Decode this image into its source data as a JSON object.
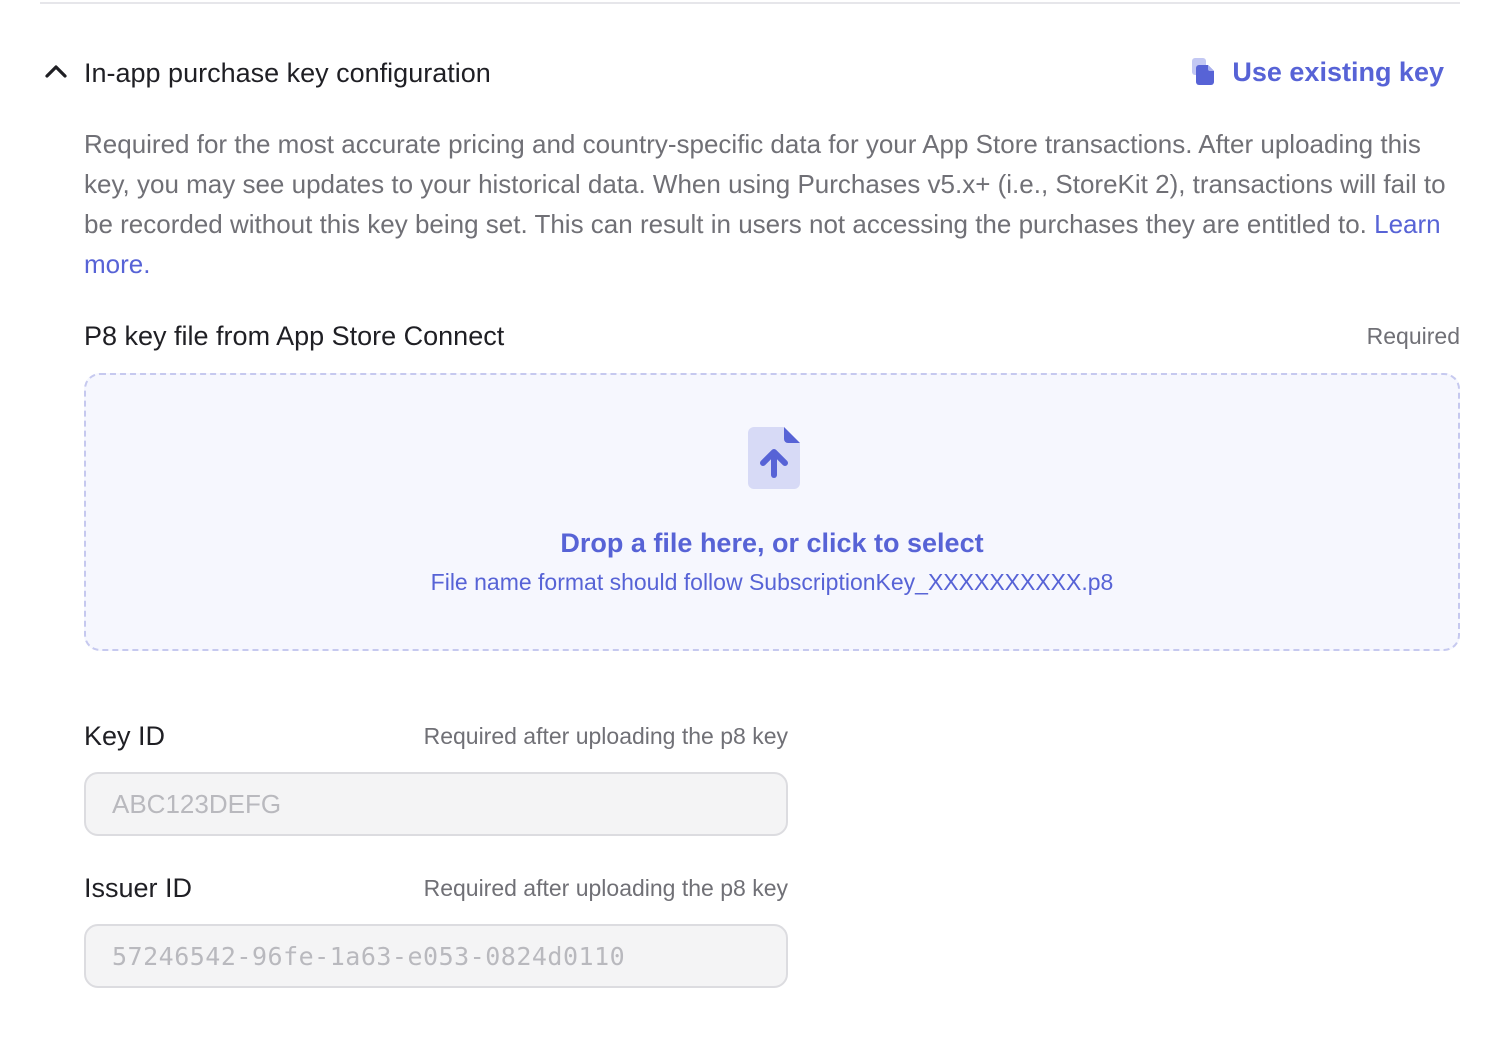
{
  "section": {
    "title": "In-app purchase key configuration",
    "use_existing_label": "Use existing key",
    "description_text": "Required for the most accurate pricing and country-specific data for your App Store transactions. After uploading this key, you may see updates to your historical data. When using Purchases v5.x+ (i.e., StoreKit 2), transactions will fail to be recorded without this key being set. This can result in users not accessing the purchases they are entitled to. ",
    "learn_more": "Learn more."
  },
  "p8_field": {
    "label": "P8 key file from App Store Connect",
    "required": "Required"
  },
  "dropzone": {
    "title": "Drop a file here, or click to select",
    "hint": "File name format should follow SubscriptionKey_XXXXXXXXXX.p8"
  },
  "key_id": {
    "label": "Key ID",
    "required": "Required after uploading the p8 key",
    "value": "",
    "placeholder": "ABC123DEFG"
  },
  "issuer_id": {
    "label": "Issuer ID",
    "required": "Required after uploading the p8 key",
    "value": "",
    "placeholder": "57246542-96fe-1a63-e053-0824d0110"
  },
  "colors": {
    "accent": "#5763d6",
    "muted_text": "#707076",
    "dropzone_bg": "#f6f7fe",
    "dropzone_border": "#c6c9ef",
    "input_bg": "#f4f4f5"
  },
  "icons": {
    "collapse": "chevron-up-icon",
    "use_existing": "copy-file-icon",
    "upload": "file-upload-icon"
  }
}
